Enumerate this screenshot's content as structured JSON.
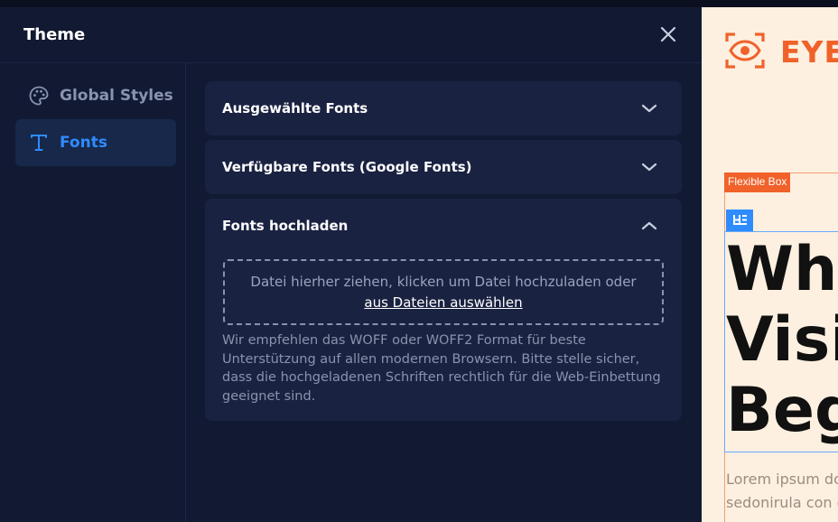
{
  "panel": {
    "title": "Theme",
    "close_icon": "close-icon"
  },
  "sidebar": {
    "items": [
      {
        "label": "Global Styles",
        "icon": "palette-icon",
        "active": false
      },
      {
        "label": "Fonts",
        "icon": "text-t-icon",
        "active": true
      }
    ]
  },
  "accordions": [
    {
      "title": "Ausgewählte Fonts",
      "expanded": false
    },
    {
      "title": "Verfügbare Fonts (Google Fonts)",
      "expanded": false
    },
    {
      "title": "Fonts hochladen",
      "expanded": true
    }
  ],
  "upload": {
    "dropzone_text": "Datei hierher ziehen, klicken um Datei hochzuladen oder",
    "dropzone_link": "aus Dateien auswählen",
    "hint": "Wir empfehlen das WOFF oder WOFF2 Format für beste Unterstützung auf allen modernen Browsern. Bitte stelle sicher, dass die hochgeladenen Schriften rechtlich für die Web-Einbettung geeignet sind."
  },
  "preview": {
    "logo_text": "EYE",
    "flex_tag": "Flexible Box",
    "headline": "Whe\nVisi\nBeg",
    "lorem": "Lorem ipsum do\nsedonirula con e",
    "colors": {
      "accent": "#f0622a",
      "selection": "#2f8cff",
      "background": "#fdf0e0"
    }
  },
  "colors": {
    "panel_bg": "#121a33",
    "card_bg": "#1a2241",
    "active_nav_bg": "#17284a",
    "active_nav_text": "#2f8cff"
  }
}
